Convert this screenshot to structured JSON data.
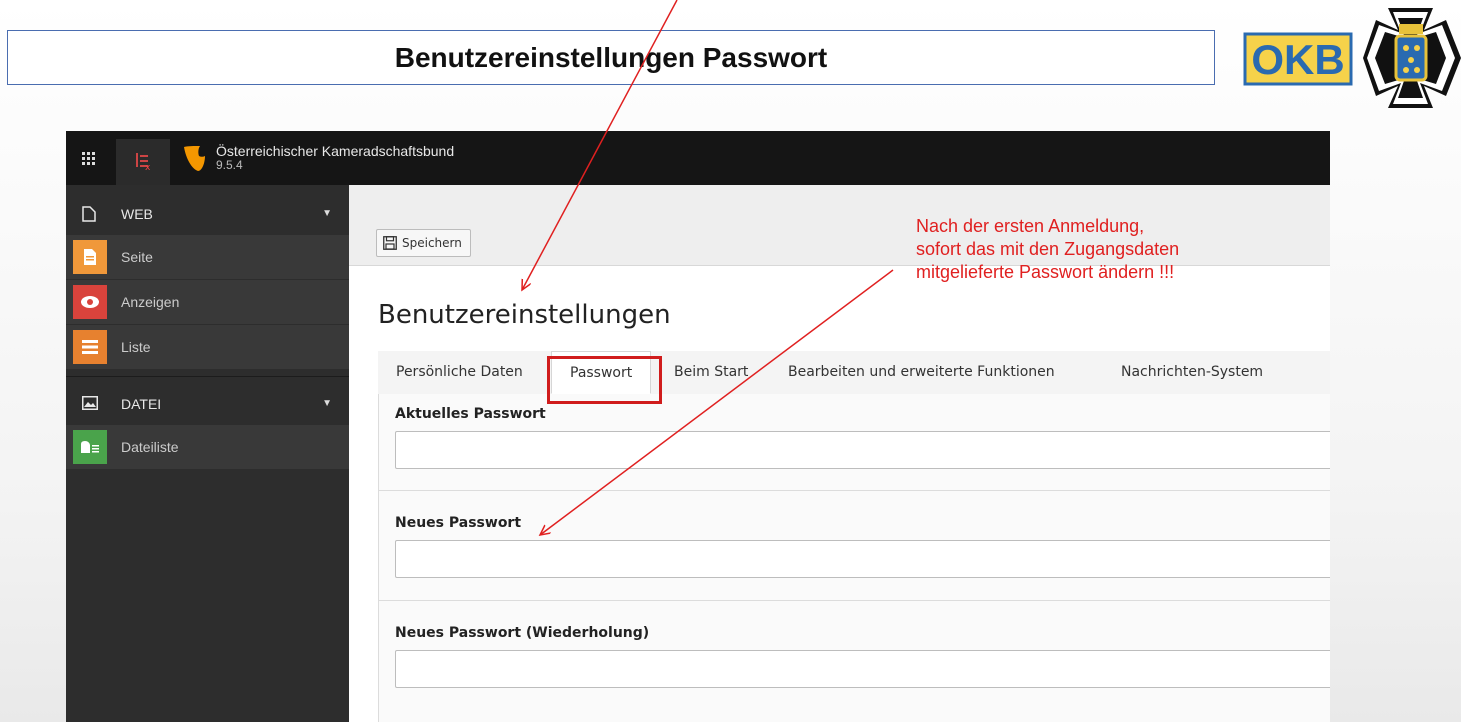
{
  "slide": {
    "title": "Benutzereinstellungen Passwort",
    "logo_text": "OKB"
  },
  "topbar": {
    "site_name": "Österreichischer Kameradschaftsbund",
    "version": "9.5.4"
  },
  "sidebar": {
    "groups": [
      {
        "label": "WEB",
        "icon": "page-icon",
        "items": [
          {
            "label": "Seite",
            "icon": "file-icon",
            "color": "#f0983a"
          },
          {
            "label": "Anzeigen",
            "icon": "eye-icon",
            "color": "#d9433c"
          },
          {
            "label": "Liste",
            "icon": "list-icon",
            "color": "#e7812f"
          }
        ]
      },
      {
        "label": "DATEI",
        "icon": "image-icon",
        "items": [
          {
            "label": "Dateiliste",
            "icon": "folder-icon",
            "color": "#4aa34b"
          }
        ]
      }
    ]
  },
  "toolbar": {
    "save_label": "Speichern"
  },
  "page": {
    "title": "Benutzereinstellungen",
    "tabs": [
      {
        "label": "Persönliche Daten",
        "active": false
      },
      {
        "label": "Passwort",
        "active": true
      },
      {
        "label": "Beim Start",
        "active": false
      },
      {
        "label": "Bearbeiten und erweiterte Funktionen",
        "active": false
      },
      {
        "label": "Nachrichten-System",
        "active": false
      }
    ],
    "fields": [
      {
        "label": "Aktuelles Passwort",
        "value": ""
      },
      {
        "label": "Neues Passwort",
        "value": ""
      },
      {
        "label": "Neues Passwort (Wiederholung)",
        "value": ""
      }
    ]
  },
  "annotation": {
    "lines": [
      "Nach der ersten Anmeldung,",
      "sofort das mit den Zugangsdaten",
      "mitgelieferte Passwort ändern !!!"
    ],
    "color": "#e02020"
  },
  "colors": {
    "topbar": "#151515",
    "sidebar": "#2d2d2d",
    "accent_red": "#d01c1c"
  }
}
